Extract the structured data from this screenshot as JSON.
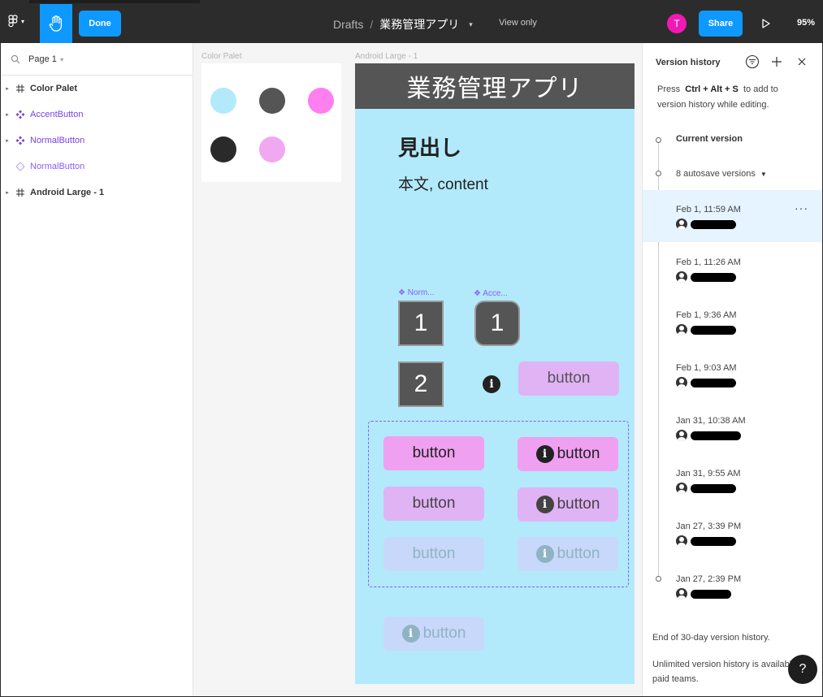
{
  "topbar": {
    "done_label": "Done",
    "breadcrumb_drafts": "Drafts",
    "breadcrumb_sep": "/",
    "file_name": "業務管理アプリ",
    "view_only": "View only",
    "avatar_initial": "T",
    "share_label": "Share",
    "zoom": "95%"
  },
  "layers": {
    "page_label": "Page 1",
    "items": [
      {
        "name": "Color Palet",
        "kind": "frame"
      },
      {
        "name": "AccentButton",
        "kind": "component"
      },
      {
        "name": "NormalButton",
        "kind": "component"
      },
      {
        "name": "NormalButton",
        "kind": "instance"
      },
      {
        "name": "Android Large - 1",
        "kind": "frame"
      }
    ]
  },
  "canvas": {
    "palette_label": "Color Palet",
    "palette_colors": [
      "#b2eafb",
      "#555555",
      "#ff7ef0",
      "#2a2a2a",
      "#f0a8f0"
    ],
    "android_label": "Android Large - 1",
    "app_title": "業務管理アプリ",
    "heading": "見出し",
    "body": "本文, content",
    "normal_label": "❖ Norm...",
    "accent_label": "❖ Acce...",
    "num1": "1",
    "num1b": "1",
    "num2": "2",
    "info_glyph": "i",
    "button_label": "button"
  },
  "colors": {
    "accent_blue": "#0d99ff",
    "component_purple": "#7b3fe4",
    "pink_strong": "#f0a0f0",
    "pink_soft": "#e0b3f5",
    "disabled": "#c8d8fa"
  },
  "version_history": {
    "title": "Version history",
    "hint_press": "Press",
    "hint_keys": "Ctrl + Alt + S",
    "hint_rest": "to add to version history while editing.",
    "current": "Current version",
    "autosave": "8 autosave versions",
    "versions": [
      {
        "date": "Feb 1, 11:59 AM"
      },
      {
        "date": "Feb 1, 11:26 AM"
      },
      {
        "date": "Feb 1, 9:36 AM"
      },
      {
        "date": "Feb 1, 9:03 AM"
      },
      {
        "date": "Jan 31, 10:38 AM"
      },
      {
        "date": "Jan 31, 9:55 AM"
      },
      {
        "date": "Jan 27, 3:39 PM"
      },
      {
        "date": "Jan 27, 2:39 PM"
      }
    ],
    "more": "···",
    "end_text": "End of 30-day version history.",
    "unlimited_text": "Unlimited version history is available to paid teams."
  },
  "help": "?"
}
